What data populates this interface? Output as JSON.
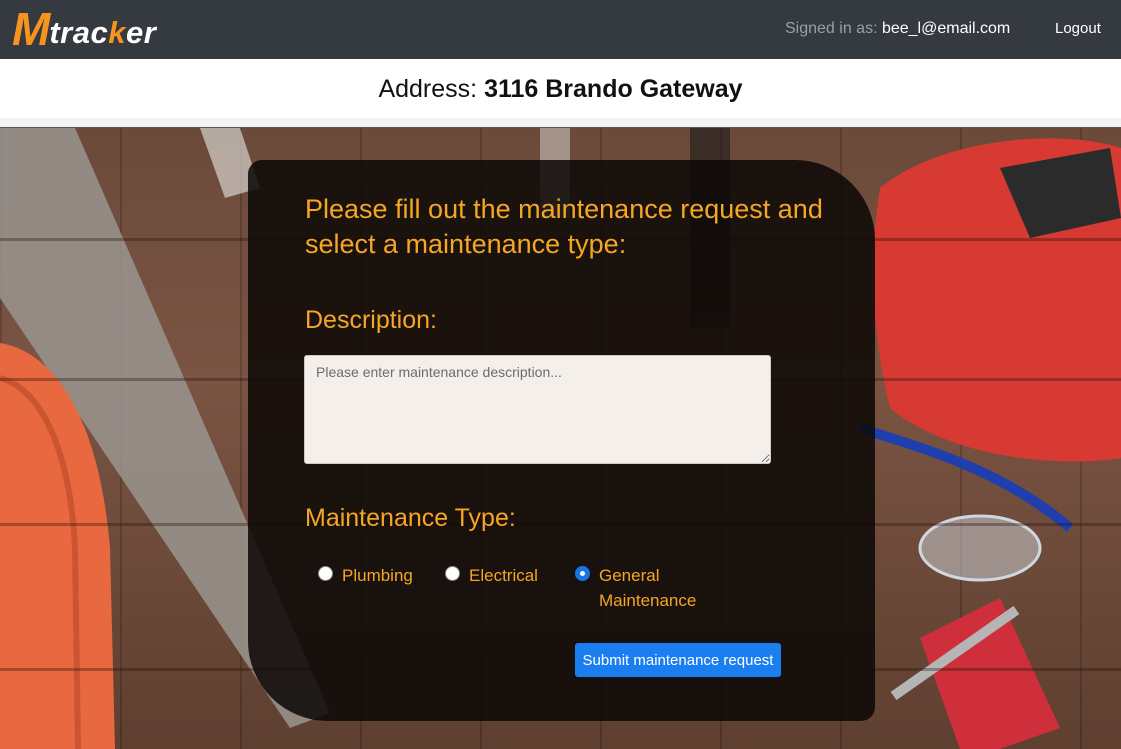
{
  "nav": {
    "logo_m": "M",
    "logo_tracker_1": "trac",
    "logo_tracker_2": "k",
    "logo_tracker_3": "er",
    "signed_in_label": "Signed in as: ",
    "signed_in_email": "bee_l@email.com",
    "logout_label": "Logout"
  },
  "address": {
    "label": "Address: ",
    "value": "3116 Brando Gateway"
  },
  "form": {
    "title": "Please fill out the maintenance request and select a maintenance type:",
    "description_label": "Description:",
    "description_placeholder": "Please enter maintenance description...",
    "description_value": "",
    "type_label": "Maintenance Type:",
    "types": [
      {
        "label": "Plumbing",
        "checked": false
      },
      {
        "label": "Electrical",
        "checked": false
      },
      {
        "label": "General Maintenance",
        "checked": true
      }
    ],
    "submit_label": "Submit maintenance request"
  },
  "colors": {
    "navbar": "#343a40",
    "accent_orange": "#f5a623",
    "logo_orange": "#f7941d",
    "button_blue": "#1a7ef0",
    "card_bg": "#0c0806"
  },
  "icons": [
    "mtracker-logo",
    "radio-icon"
  ]
}
